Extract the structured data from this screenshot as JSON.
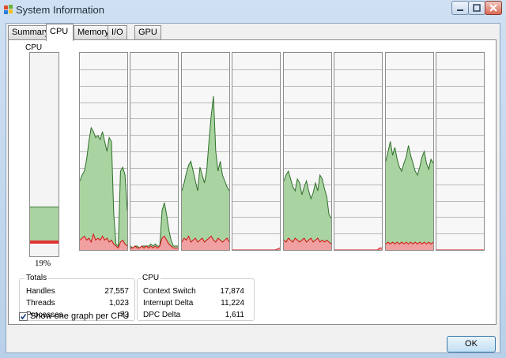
{
  "window": {
    "title": "System Information"
  },
  "tabs": [
    {
      "label": "Summary"
    },
    {
      "label": "CPU"
    },
    {
      "label": "Memory"
    },
    {
      "label": "I/O"
    },
    {
      "label": "GPU"
    }
  ],
  "cpu": {
    "group_label": "CPU",
    "usage_text": "19%",
    "usage_fraction": 0.19,
    "kernel_fraction": 0.015,
    "graphs": [
      {
        "user": [
          0.35,
          0.38,
          0.4,
          0.46,
          0.55,
          0.62,
          0.6,
          0.57,
          0.58,
          0.56,
          0.6,
          0.55,
          0.5,
          0.57,
          0.55,
          0.18,
          0.03,
          0.02,
          0.4,
          0.42,
          0.38,
          0.2
        ],
        "kernel": [
          0.05,
          0.06,
          0.07,
          0.05,
          0.06,
          0.04,
          0.08,
          0.05,
          0.06,
          0.05,
          0.07,
          0.05,
          0.06,
          0.04,
          0.05,
          0.03,
          0.02,
          0.01,
          0.04,
          0.05,
          0.03,
          0.02
        ]
      },
      {
        "user": [
          0.02,
          0.01,
          0.02,
          0.02,
          0.01,
          0.02,
          0.02,
          0.02,
          0.02,
          0.03,
          0.02,
          0.03,
          0.02,
          0.02,
          0.2,
          0.24,
          0.18,
          0.1,
          0.05,
          0.02,
          0.02,
          0.02
        ],
        "kernel": [
          0.01,
          0.01,
          0.02,
          0.01,
          0.01,
          0.02,
          0.01,
          0.02,
          0.01,
          0.02,
          0.01,
          0.02,
          0.01,
          0.02,
          0.06,
          0.07,
          0.05,
          0.03,
          0.02,
          0.01,
          0.01,
          0.01
        ]
      },
      {
        "user": [
          0.3,
          0.34,
          0.39,
          0.43,
          0.45,
          0.4,
          0.35,
          0.3,
          0.42,
          0.38,
          0.34,
          0.4,
          0.55,
          0.68,
          0.78,
          0.5,
          0.4,
          0.45,
          0.38,
          0.35,
          0.32,
          0.3
        ],
        "kernel": [
          0.04,
          0.06,
          0.05,
          0.07,
          0.04,
          0.05,
          0.06,
          0.04,
          0.05,
          0.06,
          0.04,
          0.05,
          0.06,
          0.07,
          0.05,
          0.04,
          0.06,
          0.05,
          0.04,
          0.05,
          0.06,
          0.04
        ]
      },
      {
        "user": [
          0.0,
          0.0,
          0.0,
          0.0,
          0.0,
          0.0,
          0.0,
          0.0,
          0.0,
          0.0,
          0.0,
          0.0,
          0.0,
          0.0,
          0.0,
          0.0,
          0.0,
          0.0,
          0.0,
          0.0,
          0.0,
          0.0
        ],
        "kernel": [
          0.0,
          0.0,
          0.0,
          0.0,
          0.0,
          0.0,
          0.0,
          0.0,
          0.0,
          0.0,
          0.0,
          0.0,
          0.0,
          0.0,
          0.0,
          0.0,
          0.0,
          0.0,
          0.0,
          0.0,
          0.005,
          0.01
        ]
      },
      {
        "user": [
          0.35,
          0.38,
          0.4,
          0.36,
          0.32,
          0.3,
          0.36,
          0.34,
          0.28,
          0.32,
          0.35,
          0.3,
          0.26,
          0.29,
          0.34,
          0.3,
          0.38,
          0.36,
          0.31,
          0.27,
          0.18,
          0.16
        ],
        "kernel": [
          0.05,
          0.04,
          0.06,
          0.05,
          0.04,
          0.06,
          0.05,
          0.04,
          0.05,
          0.06,
          0.04,
          0.05,
          0.06,
          0.04,
          0.05,
          0.06,
          0.04,
          0.05,
          0.04,
          0.05,
          0.04,
          0.03
        ]
      },
      {
        "user": [
          0.0,
          0.0,
          0.0,
          0.0,
          0.0,
          0.0,
          0.0,
          0.0,
          0.0,
          0.0,
          0.0,
          0.0,
          0.0,
          0.0,
          0.0,
          0.0,
          0.0,
          0.0,
          0.0,
          0.0,
          0.0,
          0.0
        ],
        "kernel": [
          0.0,
          0.0,
          0.0,
          0.0,
          0.0,
          0.0,
          0.0,
          0.0,
          0.0,
          0.0,
          0.0,
          0.0,
          0.0,
          0.0,
          0.0,
          0.0,
          0.0,
          0.0,
          0.0,
          0.0,
          0.01,
          0.01
        ]
      },
      {
        "user": [
          0.45,
          0.5,
          0.55,
          0.48,
          0.52,
          0.46,
          0.42,
          0.4,
          0.44,
          0.47,
          0.53,
          0.48,
          0.44,
          0.4,
          0.38,
          0.42,
          0.47,
          0.5,
          0.44,
          0.41,
          0.46,
          0.44
        ],
        "kernel": [
          0.03,
          0.04,
          0.03,
          0.04,
          0.03,
          0.04,
          0.03,
          0.04,
          0.03,
          0.04,
          0.03,
          0.04,
          0.03,
          0.04,
          0.03,
          0.04,
          0.03,
          0.04,
          0.03,
          0.04,
          0.03,
          0.04
        ]
      },
      {
        "user": [
          0.0,
          0.0,
          0.0,
          0.0,
          0.0,
          0.0,
          0.0,
          0.0,
          0.0,
          0.0,
          0.0,
          0.0,
          0.0,
          0.0,
          0.0,
          0.0,
          0.0,
          0.0,
          0.0,
          0.0,
          0.0,
          0.0
        ],
        "kernel": [
          0.0,
          0.0,
          0.0,
          0.0,
          0.0,
          0.0,
          0.0,
          0.0,
          0.0,
          0.0,
          0.0,
          0.0,
          0.0,
          0.0,
          0.0,
          0.0,
          0.0,
          0.0,
          0.0,
          0.0,
          0.0,
          0.0
        ]
      }
    ]
  },
  "totals": {
    "label": "Totals",
    "rows": [
      {
        "label": "Handles",
        "value": "27,557"
      },
      {
        "label": "Threads",
        "value": "1,023"
      },
      {
        "label": "Processes",
        "value": "73"
      }
    ]
  },
  "cpu_stats": {
    "label": "CPU",
    "rows": [
      {
        "label": "Context Switch",
        "value": "17,874"
      },
      {
        "label": "Interrupt Delta",
        "value": "11,224"
      },
      {
        "label": "DPC Delta",
        "value": "1,611"
      }
    ]
  },
  "checkbox": {
    "label": "Show one graph per CPU",
    "checked": true
  },
  "ok_label": "OK",
  "colors": {
    "user_fill": "#a9d3a1",
    "user_line": "#2f6f2a",
    "kernel_fill": "#f0a0a0",
    "kernel_line": "#d01010",
    "grid": "#b9b9b9"
  }
}
